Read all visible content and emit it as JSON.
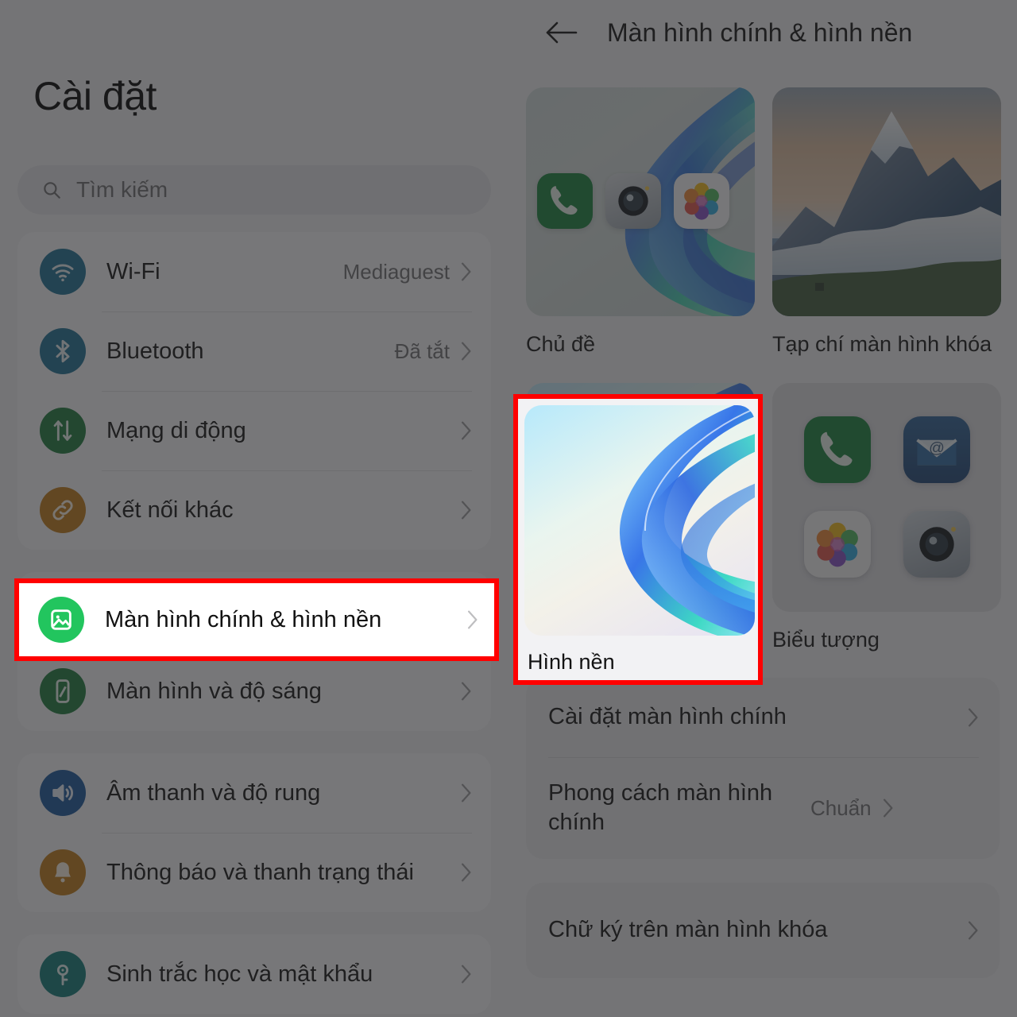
{
  "settings_panel": {
    "title": "Cài đặt",
    "search": {
      "placeholder": "Tìm kiếm",
      "icon": "search-icon"
    },
    "groups": [
      {
        "rows": [
          {
            "label": "Wi-Fi",
            "value": "Mediaguest",
            "icon": "wifi-icon",
            "icon_color": "#1b6e94"
          },
          {
            "label": "Bluetooth",
            "value": "Đã tắt",
            "icon": "bluetooth-icon",
            "icon_color": "#1b6e94"
          },
          {
            "label": "Mạng di động",
            "value": "",
            "icon": "cellular-icon",
            "icon_color": "#1b7a3c"
          },
          {
            "label": "Kết nối khác",
            "value": "",
            "icon": "link-icon",
            "icon_color": "#c07a15"
          }
        ]
      },
      {
        "rows": [
          {
            "label": "Màn hình chính & hình nền",
            "value": "",
            "icon": "image-icon",
            "icon_color": "#22c55e",
            "highlighted": true
          },
          {
            "label": "Màn hình và độ sáng",
            "value": "",
            "icon": "phone-brightness-icon",
            "icon_color": "#1b7a3c"
          }
        ]
      },
      {
        "rows": [
          {
            "label": "Âm thanh và độ rung",
            "value": "",
            "icon": "speaker-icon",
            "icon_color": "#16559c"
          },
          {
            "label": "Thông báo và thanh trạng thái",
            "value": "",
            "icon": "bell-icon",
            "icon_color": "#c07a15"
          }
        ]
      },
      {
        "rows": [
          {
            "label": "Sinh trắc học và mật khẩu",
            "value": "",
            "icon": "key-icon",
            "icon_color": "#0f7a78"
          }
        ]
      }
    ]
  },
  "detail_panel": {
    "back_icon": "back-arrow-icon",
    "title": "Màn hình chính & hình nền",
    "thumbnails": [
      {
        "label": "Chủ đề",
        "art": "theme-preview"
      },
      {
        "label": "Tạp chí màn hình khóa",
        "art": "mountain-photo"
      }
    ],
    "second_row": [
      {
        "label": "Hình nền",
        "art": "wallpaper-swirl",
        "highlighted": true
      },
      {
        "label": "Biểu tượng",
        "art": "icon-pack-grid"
      }
    ],
    "list_group_1": [
      {
        "label": "Cài đặt màn hình chính",
        "value": ""
      },
      {
        "label": "Phong cách màn hình chính",
        "value": "Chuẩn"
      }
    ],
    "list_group_2": [
      {
        "label": "Chữ ký trên màn hình khóa",
        "value": ""
      }
    ]
  },
  "annotation": {
    "highlight_color": "#ff0000",
    "highlight_targets": [
      "Màn hình chính & hình nền",
      "Hình nền"
    ]
  }
}
